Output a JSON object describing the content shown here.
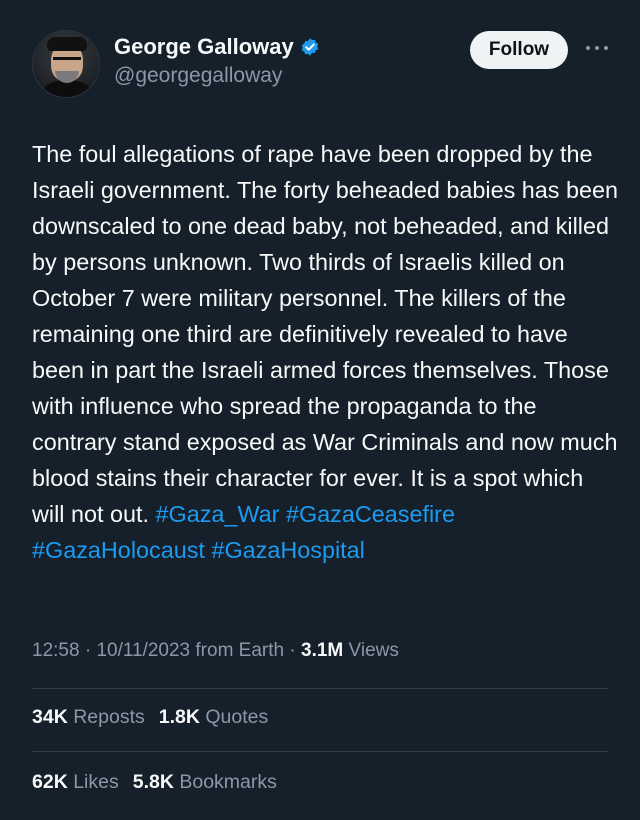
{
  "author": {
    "display_name": "George Galloway",
    "handle": "@georgegalloway",
    "verified": true
  },
  "follow_label": "Follow",
  "tweet": {
    "body": "The foul allegations of rape have been dropped by the Israeli government. The forty beheaded babies has been downscaled to one dead baby, not beheaded, and killed by persons unknown. Two thirds of Israelis killed on October 7 were military personnel. The killers of the remaining one third are definitively revealed to have been in part the Israeli armed forces themselves. Those with influence who spread the propaganda to the contrary stand exposed as War Criminals and now much blood stains their character for ever. It is a spot which will not out.",
    "hashtags": [
      "#Gaza_War",
      "#GazaCeasefire",
      "#GazaHolocaust",
      "#GazaHospital"
    ]
  },
  "meta": {
    "time": "12:58",
    "date": "10/11/2023",
    "source": "from Earth",
    "views_count": "3.1M",
    "views_label": "Views"
  },
  "stats": {
    "reposts_count": "34K",
    "reposts_label": "Reposts",
    "quotes_count": "1.8K",
    "quotes_label": "Quotes",
    "likes_count": "62K",
    "likes_label": "Likes",
    "bookmarks_count": "5.8K",
    "bookmarks_label": "Bookmarks"
  },
  "colors": {
    "background": "#15202b",
    "link": "#1d9bf0",
    "verified": "#1d9bf0",
    "secondary_text": "#8b98a5"
  }
}
